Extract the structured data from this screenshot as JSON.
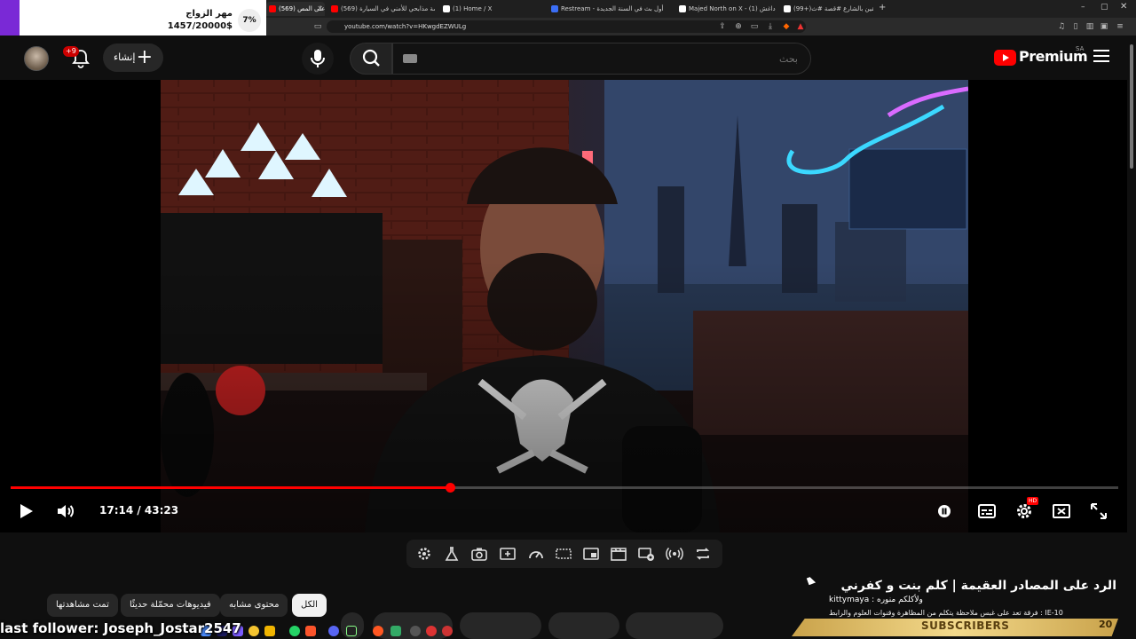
{
  "browser": {
    "tabs": [
      {
        "label": "(569) الرد على المص",
        "color": "#ff0000",
        "active": true
      },
      {
        "label": "(569) قصة مذابحي للأمني في السيارة",
        "color": "#ff0000",
        "active": false
      },
      {
        "label": "(1) Home / X",
        "color": "#ffffff",
        "active": false
      },
      {
        "label": "Restream - أول بث في السنة الجديدة",
        "color": "#3b6ef5",
        "active": false
      },
      {
        "label": "Majed North on X - (1) ابو داغش",
        "color": "#ffffff",
        "active": false
      },
      {
        "label": "(99+)قصة صديقين بالشارع #قصة #ث",
        "color": "#ffffff",
        "active": false
      }
    ],
    "new_tab": "+",
    "url": "youtube.com/watch?v=HKwgdEZWULg"
  },
  "overlay": {
    "goal_title": "مهر الزواج",
    "goal_amount": "1457/20000$",
    "goal_percent": "7%",
    "accent": "#7a29d6"
  },
  "header": {
    "notification_count": "+9",
    "create_label": "إنشاء",
    "search_placeholder": "بحث",
    "logo_word": "Premium",
    "country_code": "SA"
  },
  "player": {
    "current_time": "17:14",
    "duration": "43:23",
    "time_display": "17:14 / 43:23",
    "progress_fraction": 0.397,
    "accent": "#ff0000",
    "hd_badge": "HD"
  },
  "chips": [
    {
      "label": "الكل",
      "active": true
    },
    {
      "label": "محتوى مشابه",
      "active": false
    },
    {
      "label": "فيديوهات محمّلة حديثًا",
      "active": false
    },
    {
      "label": "تمت مشاهدتها",
      "active": false
    }
  ],
  "video": {
    "title": "الرد على المصادر العقيمة | كلم بنت و كفرني"
  },
  "stream_overlay": {
    "chat_user": "kittymaya : ولأكلكم منوره",
    "chat_msg": "فرقة تعد على غبس ملاحظة يتكلم من المظاهرة وقنوات العلوم والرابط : IE-10",
    "sub_banner": "SUBSCRIBERS",
    "sub_count": "20",
    "last_follower": "last follower: Joseph_Jostar2547"
  }
}
